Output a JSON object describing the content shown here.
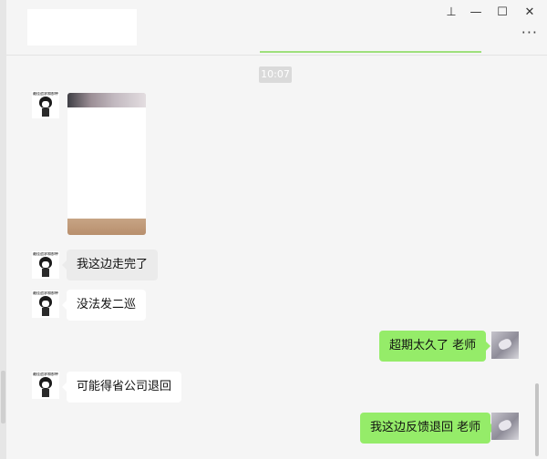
{
  "window": {
    "controls": {
      "pin": "⊥",
      "minimize": "—",
      "maximize": "☐",
      "close": "✕"
    },
    "more": "···"
  },
  "chat": {
    "timestamp": "10:07",
    "messages": [
      {
        "id": "m1",
        "sender": "other",
        "type": "image"
      },
      {
        "id": "m2",
        "sender": "other",
        "type": "text",
        "text": "我这边走完了"
      },
      {
        "id": "m3",
        "sender": "other",
        "type": "text",
        "text": "没法发二巡"
      },
      {
        "id": "m4",
        "sender": "me",
        "type": "text",
        "text": "超期太久了 老师"
      },
      {
        "id": "m5",
        "sender": "other",
        "type": "text",
        "text": "可能得省公司退回"
      },
      {
        "id": "m6",
        "sender": "me",
        "type": "text",
        "text": "我这边反馈退回 老师"
      }
    ],
    "avatar_caption": "最佳追求和那种"
  },
  "colors": {
    "background": "#f5f5f5",
    "my_bubble": "#95ec69",
    "their_bubble": "#ffffff"
  }
}
